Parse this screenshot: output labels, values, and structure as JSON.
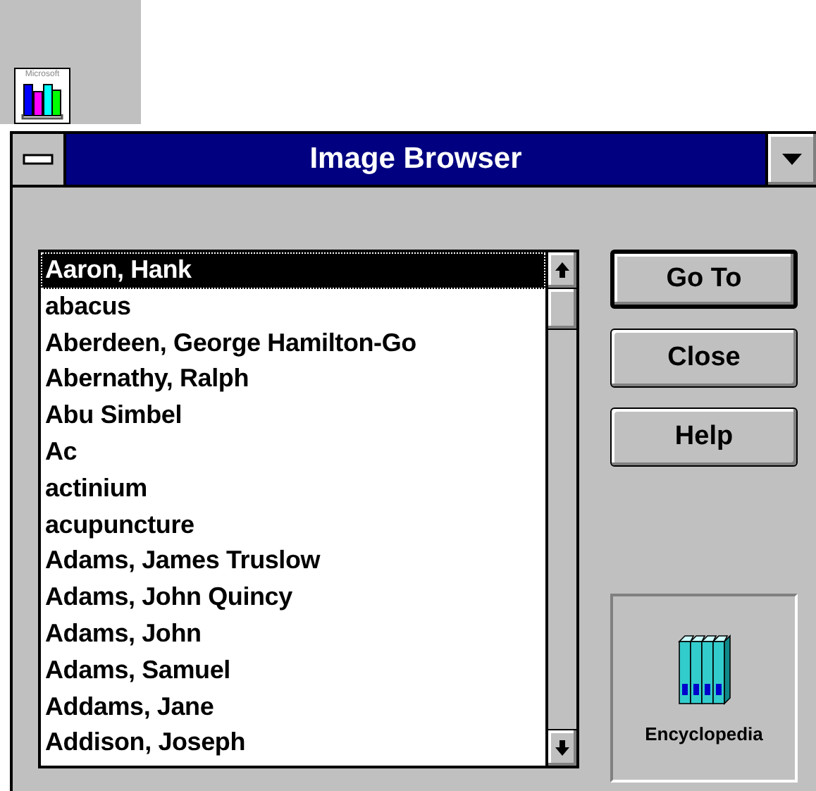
{
  "desktop_icon": {
    "caption": "Microsoft"
  },
  "window": {
    "title": "Image Browser"
  },
  "list": {
    "items": [
      {
        "label": "Aaron, Hank",
        "selected": true
      },
      {
        "label": "abacus",
        "selected": false
      },
      {
        "label": "Aberdeen, George Hamilton-Go",
        "selected": false
      },
      {
        "label": "Abernathy, Ralph",
        "selected": false
      },
      {
        "label": "Abu Simbel",
        "selected": false
      },
      {
        "label": "Ac",
        "selected": false
      },
      {
        "label": "actinium",
        "selected": false
      },
      {
        "label": "acupuncture",
        "selected": false
      },
      {
        "label": "Adams, James Truslow",
        "selected": false
      },
      {
        "label": "Adams, John Quincy",
        "selected": false
      },
      {
        "label": "Adams, John",
        "selected": false
      },
      {
        "label": "Adams, Samuel",
        "selected": false
      },
      {
        "label": "Addams, Jane",
        "selected": false
      },
      {
        "label": "Addison, Joseph",
        "selected": false
      }
    ]
  },
  "buttons": [
    {
      "label": "Go To",
      "default": true
    },
    {
      "label": "Close",
      "default": false
    },
    {
      "label": "Help",
      "default": false
    }
  ],
  "source": {
    "label": "Encyclopedia"
  }
}
